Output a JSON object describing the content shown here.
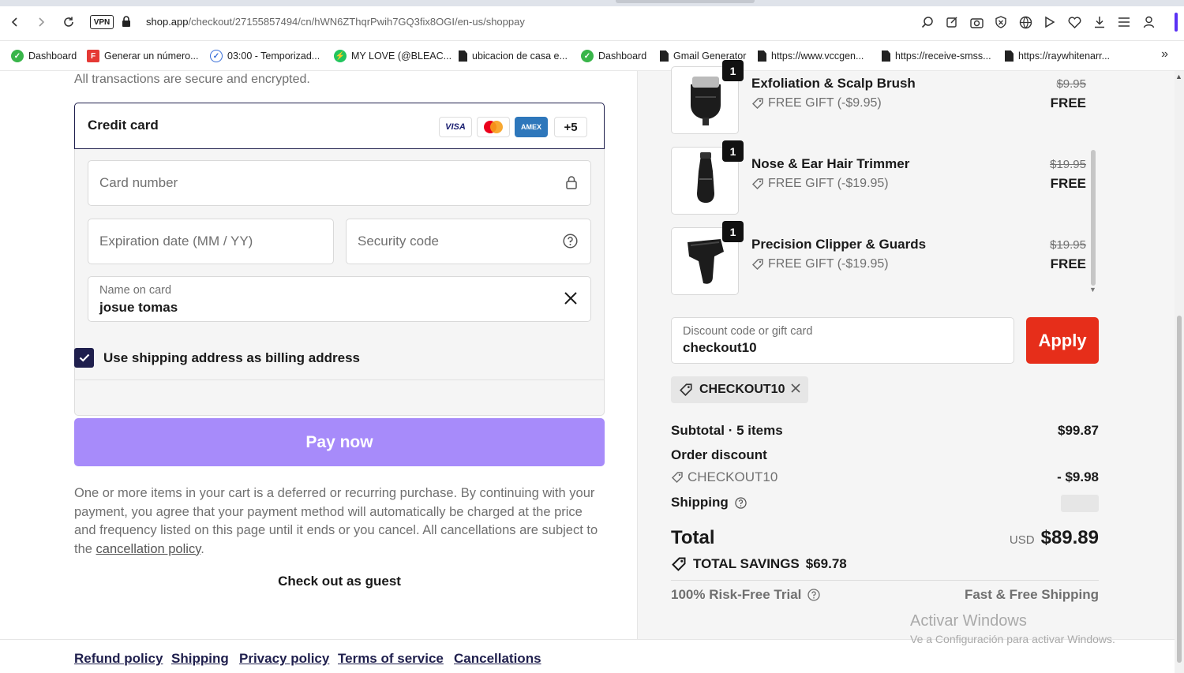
{
  "browser": {
    "vpn_label": "VPN",
    "url_host": "shop.app",
    "url_path": "/checkout/27155857494/cn/hWN6ZThqrPwih7GQ3fix8OGI/en-us/shoppay",
    "bookmarks": [
      {
        "label": "Dashboard",
        "icon": "green-circle-icon"
      },
      {
        "label": "Generar un número...",
        "icon": "red-f-icon"
      },
      {
        "label": "03:00 - Temporizad...",
        "icon": "check-clock-icon"
      },
      {
        "label": "MY LOVE (@BLEAC...",
        "icon": "green-bolt-icon"
      },
      {
        "label": "ubicacion de casa e...",
        "icon": "document-icon"
      },
      {
        "label": "Dashboard",
        "icon": "green-circle-icon"
      },
      {
        "label": "Gmail Generator",
        "icon": "document-icon"
      },
      {
        "label": "https://www.vccgen...",
        "icon": "document-icon"
      },
      {
        "label": "https://receive-smss...",
        "icon": "document-icon"
      },
      {
        "label": "https://raywhitenarr...",
        "icon": "document-icon"
      }
    ]
  },
  "payment": {
    "secure_text": "All transactions are secure and encrypted.",
    "method_title": "Credit card",
    "card_logos": [
      "VISA",
      "Mastercard",
      "AMEX",
      "+5"
    ],
    "card_number_placeholder": "Card number",
    "expiration_placeholder": "Expiration date (MM / YY)",
    "security_code_placeholder": "Security code",
    "name_label": "Name on card",
    "name_value": "josue tomas",
    "billing_checkbox_label": "Use shipping address as billing address",
    "billing_checked": true,
    "pay_button": "Pay now",
    "notice_text": "One or more items in your cart is a deferred or recurring purchase. By continuing with your payment, you agree that your payment method will automatically be charged at the price and frequency listed on this page until it ends or you cancel. All cancellations are subject to the ",
    "notice_link": "cancellation policy",
    "notice_end": ".",
    "guest_link": "Check out as guest"
  },
  "footer": {
    "links": [
      "Refund policy",
      "Shipping",
      "Privacy policy",
      "Terms of service",
      "Cancellations"
    ]
  },
  "summary": {
    "items": [
      {
        "name": "Exfoliation & Scalp Brush",
        "gift": "FREE GIFT (-$9.95)",
        "original_price": "$9.95",
        "price": "FREE",
        "quantity": "1"
      },
      {
        "name": "Nose & Ear Hair Trimmer",
        "gift": "FREE GIFT (-$19.95)",
        "original_price": "$19.95",
        "price": "FREE",
        "quantity": "1"
      },
      {
        "name": "Precision Clipper & Guards",
        "gift": "FREE GIFT (-$19.95)",
        "original_price": "$19.95",
        "price": "FREE",
        "quantity": "1"
      }
    ],
    "discount_label": "Discount code or gift card",
    "discount_value": "checkout10",
    "apply_button": "Apply",
    "applied_code": "CHECKOUT10",
    "subtotal_label": "Subtotal · 5 items",
    "subtotal_value": "$99.87",
    "order_discount_label": "Order discount",
    "discount_code": "CHECKOUT10",
    "discount_amount": "- $9.98",
    "shipping_label": "Shipping",
    "total_label": "Total",
    "currency": "USD",
    "total_value": "$89.89",
    "savings_label": "TOTAL SAVINGS",
    "savings_value": "$69.78",
    "trust_left": "100% Risk-Free Trial",
    "trust_right": "Fast & Free Shipping"
  },
  "watermark": {
    "line1": "Activar Windows",
    "line2": "Ve a Configuración para activar Windows."
  },
  "colors": {
    "pay_button": "#a78bfa",
    "apply_button": "#e62e1a",
    "accent_navy": "#1f1f4d"
  }
}
